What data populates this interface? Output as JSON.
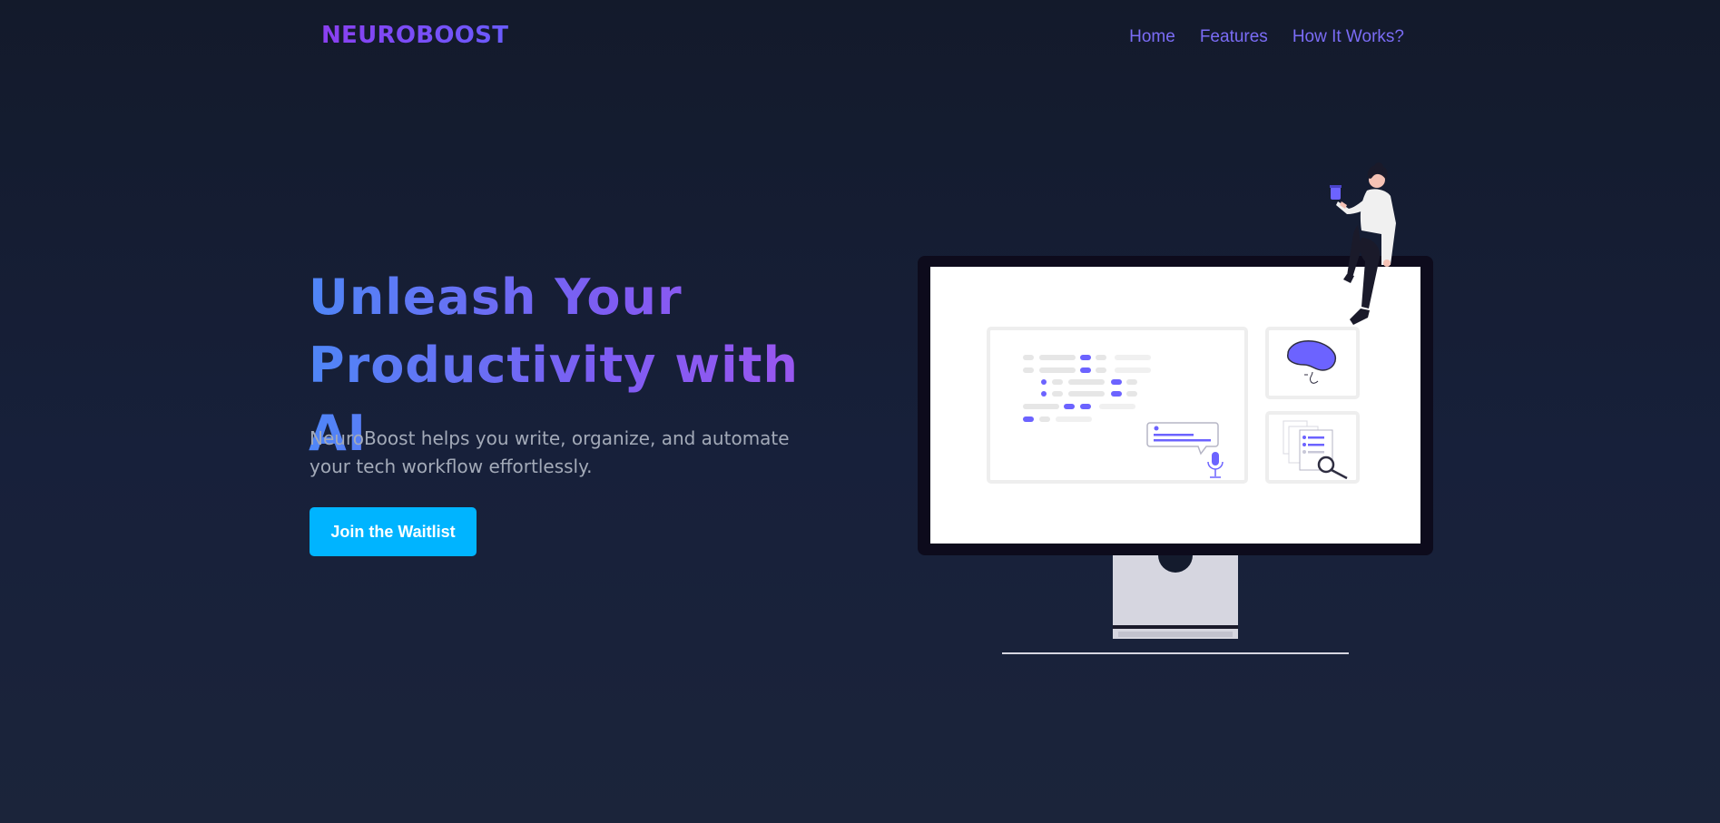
{
  "brand": {
    "name": "NEUROBOOST"
  },
  "nav": {
    "links": [
      {
        "label": "Home"
      },
      {
        "label": "Features"
      },
      {
        "label": "How It Works?"
      }
    ]
  },
  "hero": {
    "title_line1": "Unleash Your",
    "title_line2": "Productivity with AI",
    "subtitle_line1": "NeuroBoost helps you write, organize, and automate",
    "subtitle_line2": "your tech workflow effortlessly.",
    "cta_label": "Join the Waitlist"
  },
  "illustration": {
    "icons": [
      "person-icon",
      "monitor-icon",
      "brain-icon",
      "microphone-icon",
      "magnifier-icon",
      "document-icon"
    ]
  },
  "colors": {
    "background": "#141b2d",
    "brand_gradient_start": "#8a3ff0",
    "brand_gradient_end": "#6a5cff",
    "nav_link": "#7b6cf6",
    "title_gradient_start": "#4f86f7",
    "title_gradient_end": "#a155ef",
    "subtitle": "#a3aab8",
    "cta_bg": "#00b4ff",
    "accent_purple": "#6c63ff"
  }
}
